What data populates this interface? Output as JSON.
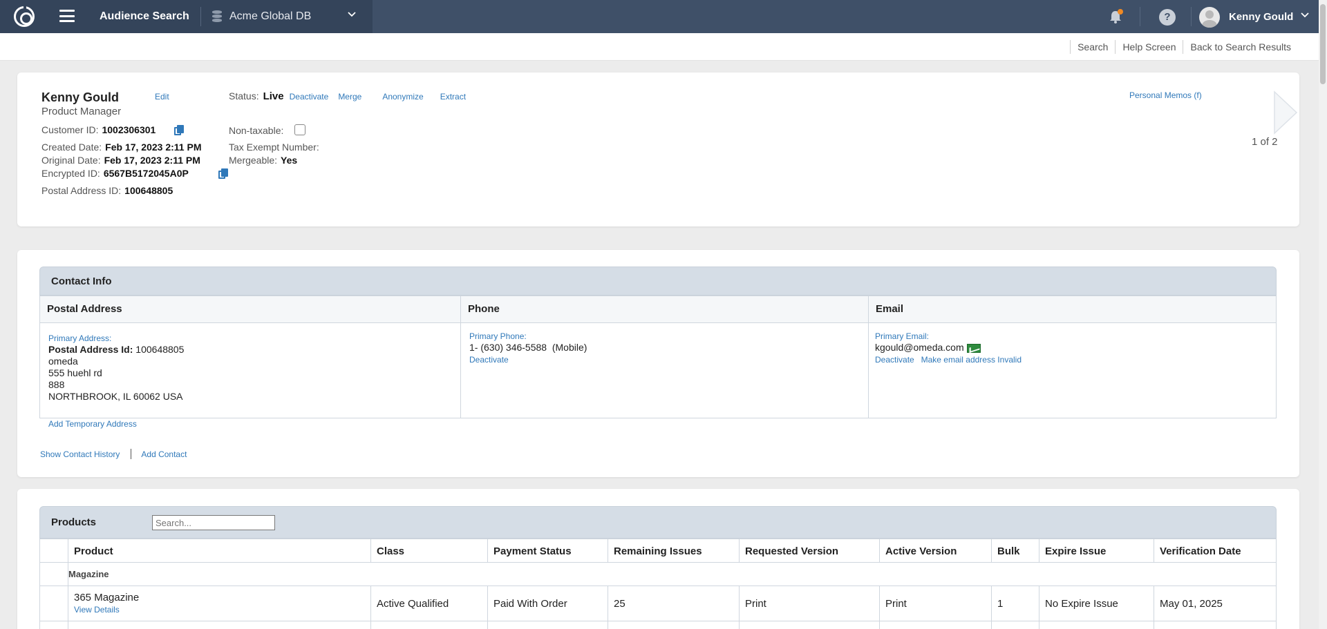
{
  "topbar": {
    "app_title": "Audience Search",
    "db_name": "Acme Global DB",
    "user_name": "Kenny Gould"
  },
  "sublinks": [
    "Search",
    "Help Screen",
    "Back to Search Results"
  ],
  "customer": {
    "name": "Kenny Gould",
    "title": "Product Manager",
    "edit_label": "Edit",
    "customer_id_label": "Customer ID:",
    "customer_id": "1002306301",
    "created_label": "Created Date:",
    "created": "Feb 17, 2023 2:11 PM",
    "original_label": "Original Date:",
    "original": "Feb 17, 2023 2:11 PM",
    "encrypted_label": "Encrypted ID:",
    "encrypted": "6567B5172045A0P",
    "postal_label": "Postal Address ID:",
    "postal_id": "100648805",
    "status_label": "Status:",
    "status": "Live",
    "actions": [
      "Deactivate",
      "Merge",
      "Anonymize",
      "Extract"
    ],
    "nontaxable_label": "Non-taxable:",
    "tax_exempt_label": "Tax Exempt Number:",
    "mergeable_label": "Mergeable:",
    "mergeable": "Yes",
    "memos_label": "Personal Memos (f)",
    "pager": "1 of 2"
  },
  "contact": {
    "section_title": "Contact Info",
    "postal": {
      "header": "Postal Address",
      "label": "Primary Address:",
      "id_label": "Postal Address Id:",
      "id": "100648805",
      "line1": "omeda",
      "line2": "555 huehl rd",
      "line3": "888",
      "line4": "NORTHBROOK, IL 60062 USA",
      "add_temp": "Add Temporary Address"
    },
    "phone": {
      "header": "Phone",
      "label": "Primary Phone:",
      "number": "1- (630) 346-5588  (Mobile)",
      "deactivate": "Deactivate"
    },
    "email": {
      "header": "Email",
      "label": "Primary Email:",
      "address": "kgould@omeda.com",
      "deactivate": "Deactivate",
      "invalid": "Make email address Invalid"
    },
    "show_history": "Show Contact History",
    "add_contact": "Add Contact"
  },
  "products": {
    "title": "Products",
    "search_placeholder": "Search...",
    "columns": [
      "Product",
      "Class",
      "Payment Status",
      "Remaining Issues",
      "Requested Version",
      "Active Version",
      "Bulk",
      "Expire Issue",
      "Verification Date"
    ],
    "group": "Magazine",
    "row": {
      "product": "365 Magazine",
      "view_details": "View Details",
      "class": "Active Qualified",
      "payment": "Paid With Order",
      "remaining": "25",
      "requested": "Print",
      "active": "Print",
      "bulk": "1",
      "expire": "No Expire Issue",
      "verified": "May 01, 2025"
    }
  }
}
